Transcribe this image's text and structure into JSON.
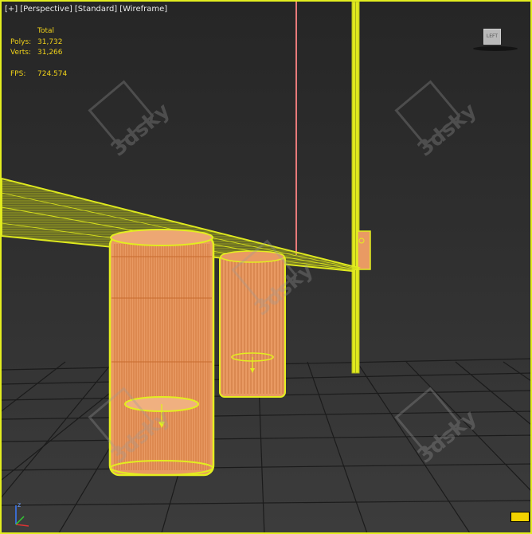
{
  "viewport": {
    "labels": [
      "[+]",
      "[Perspective]",
      "[Standard]",
      "[Wireframe]"
    ]
  },
  "stats": {
    "header": "Total",
    "polys_label": "Polys:",
    "polys_value": "31,732",
    "verts_label": "Verts:",
    "verts_value": "31,266",
    "fps_label": "FPS:",
    "fps_value": "724.574"
  },
  "viewcube": {
    "face_label": "LEFT"
  },
  "axis": {
    "z": "z",
    "x": "x",
    "y": "y"
  },
  "watermark": {
    "text": "3dsky"
  },
  "colors": {
    "selection": "#e3ee1f",
    "grid": "#1d1d1d",
    "object_fill": "#e99a63",
    "wire_edge": "#c86a2e",
    "label_text": "#e8e8e8",
    "stats_text": "#f0d21a",
    "watermark": "#9a9a9a"
  }
}
